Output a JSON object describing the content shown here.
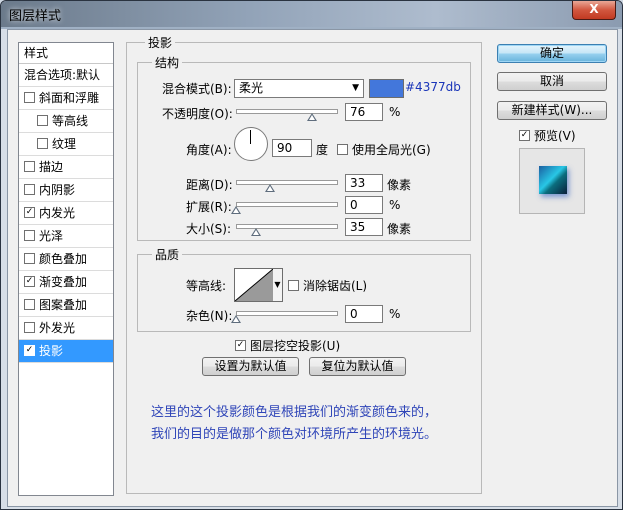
{
  "window": {
    "title": "图层样式",
    "close_label": "X"
  },
  "sidebar": {
    "header": "样式",
    "items": [
      {
        "label": "混合选项:默认",
        "checkbox": false,
        "checked": false,
        "indent": false,
        "active": false
      },
      {
        "label": "斜面和浮雕",
        "checkbox": true,
        "checked": false,
        "indent": false,
        "active": false
      },
      {
        "label": "等高线",
        "checkbox": true,
        "checked": false,
        "indent": true,
        "active": false
      },
      {
        "label": "纹理",
        "checkbox": true,
        "checked": false,
        "indent": true,
        "active": false
      },
      {
        "label": "描边",
        "checkbox": true,
        "checked": false,
        "indent": false,
        "active": false
      },
      {
        "label": "内阴影",
        "checkbox": true,
        "checked": false,
        "indent": false,
        "active": false
      },
      {
        "label": "内发光",
        "checkbox": true,
        "checked": true,
        "indent": false,
        "active": false
      },
      {
        "label": "光泽",
        "checkbox": true,
        "checked": false,
        "indent": false,
        "active": false
      },
      {
        "label": "颜色叠加",
        "checkbox": true,
        "checked": false,
        "indent": false,
        "active": false
      },
      {
        "label": "渐变叠加",
        "checkbox": true,
        "checked": true,
        "indent": false,
        "active": false
      },
      {
        "label": "图案叠加",
        "checkbox": true,
        "checked": false,
        "indent": false,
        "active": false
      },
      {
        "label": "外发光",
        "checkbox": true,
        "checked": false,
        "indent": false,
        "active": false
      },
      {
        "label": "投影",
        "checkbox": true,
        "checked": true,
        "indent": false,
        "active": true
      }
    ]
  },
  "drop_shadow": {
    "title": "投影",
    "structure": {
      "title": "结构",
      "blend_mode_label": "混合模式(B):",
      "blend_mode_value": "柔光",
      "color_hex": "#4377db",
      "opacity_label": "不透明度(O):",
      "opacity_value": "76",
      "opacity_unit": "%",
      "opacity_fraction": 0.76,
      "angle_label": "角度(A):",
      "angle_value": "90",
      "angle_unit": "度",
      "global_light_label": "使用全局光(G)",
      "global_light_checked": false,
      "distance_label": "距离(D):",
      "distance_value": "33",
      "distance_unit": "像素",
      "spread_label": "扩展(R):",
      "spread_value": "0",
      "spread_unit": "%",
      "size_label": "大小(S):",
      "size_value": "35",
      "size_unit": "像素"
    },
    "quality": {
      "title": "品质",
      "contour_label": "等高线:",
      "anti_alias_label": "消除锯齿(L)",
      "anti_alias_checked": false,
      "noise_label": "杂色(N):",
      "noise_value": "0",
      "noise_unit": "%"
    },
    "knockout_label": "图层挖空投影(U)",
    "knockout_checked": true,
    "make_default_label": "设置为默认值",
    "reset_default_label": "复位为默认值"
  },
  "buttons": {
    "ok": "确定",
    "cancel": "取消",
    "new_style": "新建样式(W)...",
    "preview_label": "预览(V)",
    "preview_checked": true
  },
  "note": {
    "line1": "这里的这个投影颜色是根据我们的渐变颜色来的，",
    "line2": "我们的目的是做那个颜色对环境所产生的环境光。"
  },
  "colors": {
    "accent": "#3399ff",
    "shadow_color": "#4377db",
    "note_text": "#2f45b8"
  }
}
